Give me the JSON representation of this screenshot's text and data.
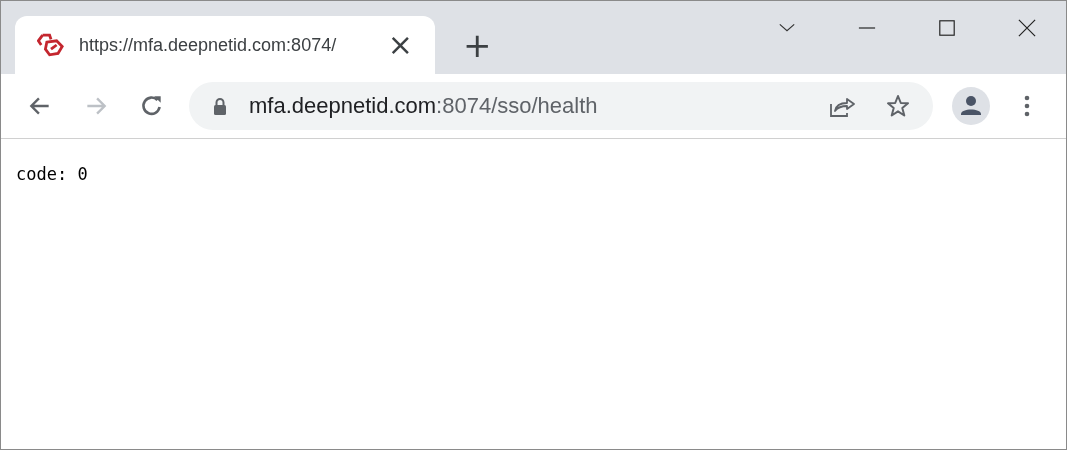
{
  "tab": {
    "title": "https://mfa.deepnetid.com:8074/",
    "close": "×",
    "selected": true
  },
  "new_tab": "+",
  "address_bar": {
    "host": "mfa.deepnetid.com",
    "rest": ":8074/sso/health"
  },
  "page": {
    "text": "code: 0"
  }
}
